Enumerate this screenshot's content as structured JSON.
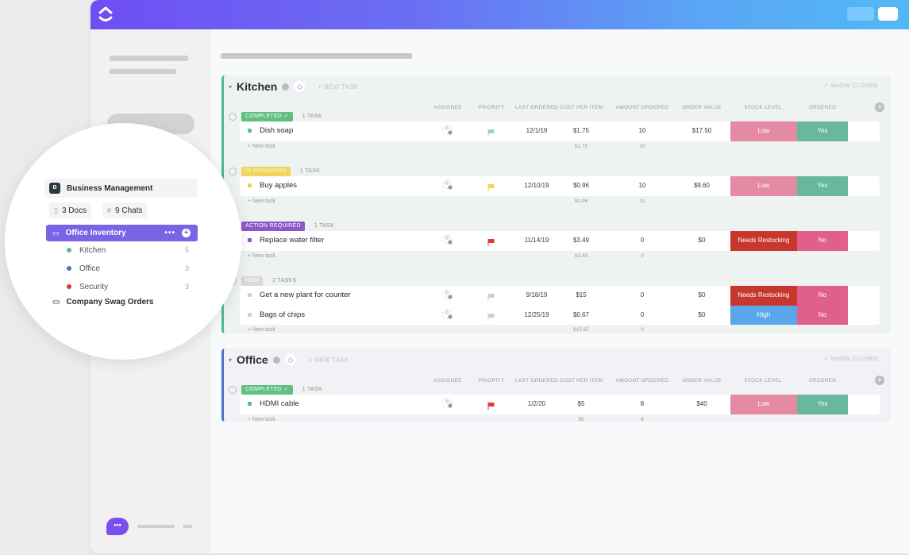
{
  "app": {
    "brand_color": "#6f4ef3",
    "accent_gradient_end": "#52b8f5"
  },
  "sidebar_zoom": {
    "workspace": {
      "avatar_letter": "B",
      "name": "Business Management"
    },
    "chips": [
      {
        "icon": "doc-icon",
        "label": "3 Docs"
      },
      {
        "icon": "hash-icon",
        "label": "9 Chats"
      }
    ],
    "active_folder": {
      "label": "Office Inventory",
      "more": "•••",
      "add": "+"
    },
    "lists": [
      {
        "label": "Kitchen",
        "count": "5",
        "color": "#4cbb8f"
      },
      {
        "label": "Office",
        "count": "3",
        "color": "#4a74c9"
      },
      {
        "label": "Security",
        "count": "3",
        "color": "#d1382e"
      }
    ],
    "other_folder": {
      "label": "Company Swag Orders"
    }
  },
  "chat": {
    "glyph": "•••"
  },
  "columns": [
    "ASSIGNEE",
    "PRIORITY",
    "LAST ORDERED",
    "COST PER ITEM",
    "AMOUNT ORDERED",
    "ORDER VALUE",
    "STOCK LEVEL",
    "ORDERED"
  ],
  "lists": [
    {
      "name": "Kitchen",
      "new_task": "+ NEW TASK",
      "show_closed": "✓ SHOW CLOSED",
      "groups": [
        {
          "status": "COMPLETED ✓",
          "status_color": "#5fbf7f",
          "count": "1 TASK",
          "tasks": [
            {
              "name": "Dish soap",
              "dot": "#5fbf7f",
              "flag": "#9fd3c7",
              "last_ordered": "12/1/19",
              "cost": "$1.75",
              "amount": "10",
              "value": "$17.50",
              "stock": "Low",
              "stock_color": "#e48aa3",
              "ordered": "Yes",
              "ordered_color": "#67b89d"
            }
          ],
          "new_task": "+ New task",
          "sum_cost": "$1.75",
          "sum_amount": "10"
        },
        {
          "status": "IN PROGRESS",
          "status_color": "#f2d55e",
          "count": "1 TASK",
          "tasks": [
            {
              "name": "Buy apples",
              "dot": "#f2cc4a",
              "flag": "#f2d55e",
              "last_ordered": "12/10/19",
              "cost": "$0.96",
              "amount": "10",
              "value": "$9.60",
              "stock": "Low",
              "stock_color": "#e48aa3",
              "ordered": "Yes",
              "ordered_color": "#67b89d"
            }
          ],
          "new_task": "+ New task",
          "sum_cost": "$0.96",
          "sum_amount": "10"
        },
        {
          "status": "ACTION REQUIRED",
          "status_color": "#8e57c9",
          "count": "1 TASK",
          "tasks": [
            {
              "name": "Replace water filter",
              "dot": "#8e57c9",
              "flag": "#e0393a",
              "last_ordered": "11/14/19",
              "cost": "$3.49",
              "amount": "0",
              "value": "$0",
              "stock": "Needs Restocking",
              "stock_color": "#c8372d",
              "ordered": "No",
              "ordered_color": "#e0608a"
            }
          ],
          "new_task": "+ New task",
          "sum_cost": "$3.49",
          "sum_amount": "0"
        },
        {
          "status": "NEW",
          "status_color": "#d9d9d9",
          "count": "2 TASKS",
          "tasks": [
            {
              "name": "Get a new plant for counter",
              "dot": "#d0d0d0",
              "flag": "#cfcfcf",
              "last_ordered": "9/18/19",
              "cost": "$15",
              "amount": "0",
              "value": "$0",
              "stock": "Needs Restocking",
              "stock_color": "#c8372d",
              "ordered": "No",
              "ordered_color": "#e0608a"
            },
            {
              "name": "Bags of chips",
              "dot": "#d0d0d0",
              "flag": "#cfcfcf",
              "last_ordered": "12/25/19",
              "cost": "$0.67",
              "amount": "0",
              "value": "$0",
              "stock": "High",
              "stock_color": "#5aa6ea",
              "ordered": "No",
              "ordered_color": "#e0608a"
            }
          ],
          "new_task": "+ New task",
          "sum_cost": "$15.67",
          "sum_amount": "0"
        }
      ]
    },
    {
      "name": "Office",
      "new_task": "+ NEW TASK",
      "show_closed": "✓ SHOW CLOSED",
      "groups": [
        {
          "status": "COMPLETED ✓",
          "status_color": "#5fbf7f",
          "count": "1 TASK",
          "tasks": [
            {
              "name": "HDMI cable",
              "dot": "#5fbf7f",
              "flag": "#e0393a",
              "last_ordered": "1/2/20",
              "cost": "$5",
              "amount": "8",
              "value": "$40",
              "stock": "Low",
              "stock_color": "#e48aa3",
              "ordered": "Yes",
              "ordered_color": "#67b89d"
            }
          ],
          "new_task": "+ New task",
          "sum_cost": "$5",
          "sum_amount": "8"
        }
      ]
    }
  ]
}
